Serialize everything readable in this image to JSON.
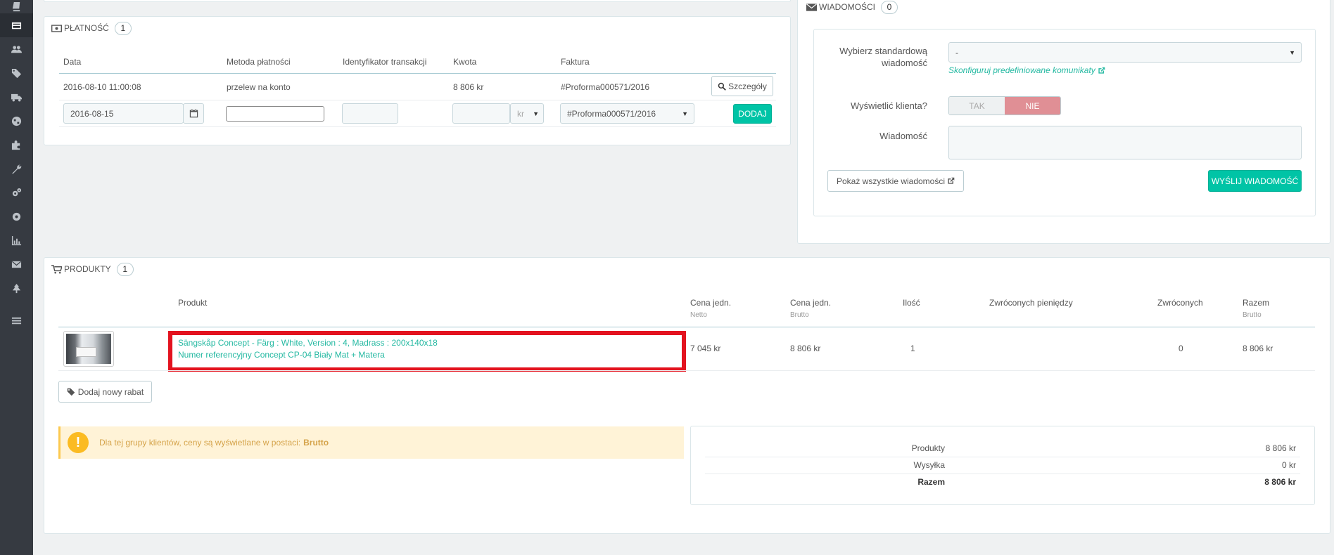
{
  "sidebar": {
    "icons": [
      "orders-icon",
      "payment-card-icon",
      "customers-icon",
      "price-tags-icon",
      "truck-icon",
      "globe-icon",
      "modules-puzzle-icon",
      "wrench-icon",
      "cogs-icon",
      "gear-icon",
      "stats-chart-icon",
      "envelope-icon",
      "tree-icon",
      "menu-list-icon"
    ],
    "active_index": 1
  },
  "payment": {
    "title": "PŁATNOŚĆ",
    "count": "1",
    "headers": [
      "Data",
      "Metoda płatności",
      "Identyfikator transakcji",
      "Kwota",
      "Faktura"
    ],
    "row": {
      "date": "2016-08-10 11:00:08",
      "method": "przelew na konto",
      "transaction_id": "",
      "amount": "8 806 kr",
      "invoice": "#Proforma000571/2016",
      "details_button": "Szczegóły"
    },
    "form": {
      "date_value": "2016-08-15",
      "method_value": "",
      "transaction_value": "",
      "amount_value": "",
      "currency_value": "kr",
      "invoice_value": "#Proforma000571/2016",
      "add_button": "DODAJ"
    }
  },
  "messages": {
    "title": "WIADOMOŚCI",
    "count": "0",
    "choose_label_1": "Wybierz standardową",
    "choose_label_2": "wiadomość",
    "choose_value": "-",
    "configure_link": "Skonfiguruj predefiniowane komunikaty",
    "show_customer_label": "Wyświetlić klienta?",
    "toggle_yes": "TAK",
    "toggle_no": "NIE",
    "message_label": "Wiadomość",
    "message_value": "",
    "show_all_button": "Pokaż wszystkie wiadomości",
    "send_button": "WYŚLIJ WIADOMOŚĆ"
  },
  "products": {
    "title": "PRODUKTY",
    "count": "1",
    "headers": {
      "product": "Produkt",
      "unit_net": "Cena jedn.",
      "unit_net_sub": "Netto",
      "unit_gross": "Cena jedn.",
      "unit_gross_sub": "Brutto",
      "qty": "Ilość",
      "refunded_money": "Zwróconych pieniędzy",
      "returned": "Zwróconych",
      "total": "Razem",
      "total_sub": "Brutto"
    },
    "rows": [
      {
        "name": "Sängskåp Concept - Färg : White, Version : 4, Madrass : 200x140x18",
        "reference": "Numer referencyjny Concept CP-04 Biały Mat + Matera",
        "unit_net": "7 045 kr",
        "unit_gross": "8 806 kr",
        "qty": "1",
        "refunded_money": "",
        "returned": "0",
        "total": "8 806 kr"
      }
    ],
    "add_discount_button": "Dodaj nowy rabat",
    "notice_text": "Dla tej grupy klientów, ceny są wyświetlane w postaci:",
    "notice_bold": "Brutto",
    "summary": [
      {
        "label": "Produkty",
        "value": "8 806 kr"
      },
      {
        "label": "Wysyłka",
        "value": "0 kr"
      },
      {
        "label": "Razem",
        "value": "8 806 kr"
      }
    ]
  },
  "colors": {
    "accent_green": "#00c4a6",
    "link_green": "#25b9a2",
    "highlight_red": "#e3131f",
    "toggle_no": "#e08f95",
    "warning_bg": "#fff3d7"
  }
}
